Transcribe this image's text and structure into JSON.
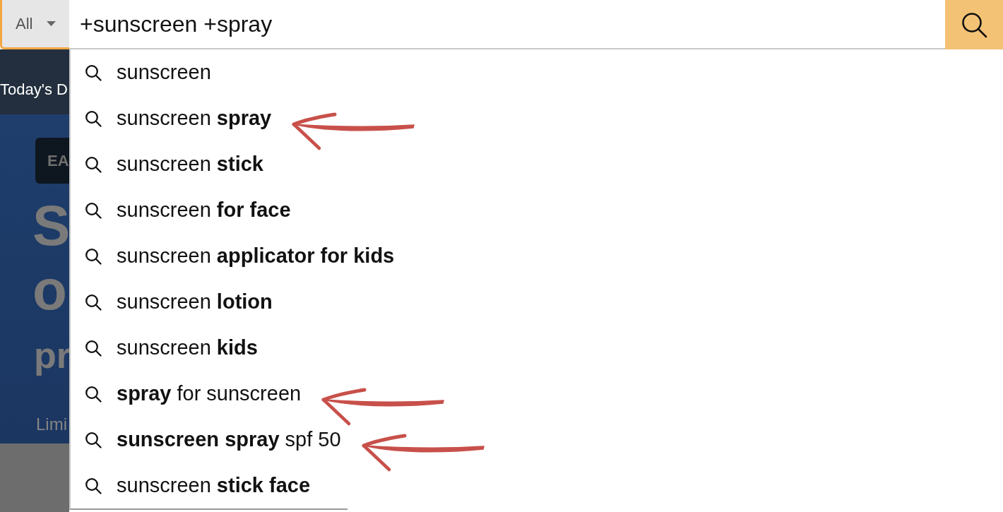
{
  "search_bar": {
    "category": "All",
    "query": "+sunscreen +spray"
  },
  "background_page": {
    "nav_link": "Today's D",
    "badge": "EA",
    "headline_lines": [
      "S",
      "o"
    ],
    "subheadline": "pr",
    "footnote": "Limi"
  },
  "suggestions": [
    {
      "text": "sunscreen",
      "annotated": false
    },
    {
      "text": "sunscreen **spray**",
      "annotated": true
    },
    {
      "text": "sunscreen **stick**",
      "annotated": false
    },
    {
      "text": "sunscreen **for face**",
      "annotated": false
    },
    {
      "text": "sunscreen **applicator for kids**",
      "annotated": false
    },
    {
      "text": "sunscreen **lotion**",
      "annotated": false
    },
    {
      "text": "sunscreen **kids**",
      "annotated": false
    },
    {
      "text": "**spray** for sunscreen",
      "annotated": true
    },
    {
      "text": "**sunscreen spray** spf 50",
      "annotated": true
    },
    {
      "text": "sunscreen **stick face**",
      "annotated": false
    }
  ]
}
